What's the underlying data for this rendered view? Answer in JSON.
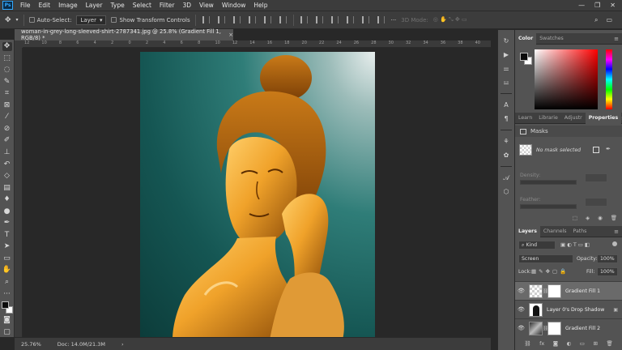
{
  "menubar": {
    "logo": "Ps",
    "items": [
      "File",
      "Edit",
      "Image",
      "Layer",
      "Type",
      "Select",
      "Filter",
      "3D",
      "View",
      "Window",
      "Help"
    ],
    "win_min": "—",
    "win_max": "❐",
    "win_close": "✕"
  },
  "options": {
    "auto_select_label": "Auto-Select:",
    "auto_select_value": "Layer",
    "transform_label": "Show Transform Controls",
    "mode_3d": "3D Mode:"
  },
  "document": {
    "tab_title": "woman-in-grey-long-sleeved-shirt-2787341.jpg @ 25.8% (Gradient Fill 1, RGB/8) *",
    "close_glyph": "×",
    "zoom": "25.76%",
    "doc_info": "Doc: 14.0M/21.3M",
    "ruler_ticks": [
      "12",
      "10",
      "8",
      "6",
      "4",
      "2",
      "0",
      "2",
      "4",
      "6",
      "8",
      "10",
      "12",
      "14",
      "16",
      "18",
      "20",
      "22",
      "24",
      "26",
      "28",
      "30",
      "32",
      "34",
      "36",
      "38",
      "40"
    ]
  },
  "color_panel": {
    "tabs": [
      "Color",
      "Swatches"
    ],
    "fg_color": "#0c0c0c",
    "bg_color": "#ffffff"
  },
  "properties_panel": {
    "tabs": [
      "Learn",
      "Librarie",
      "Adjustr",
      "Properties"
    ],
    "section": "Masks",
    "mask_status": "No mask selected",
    "density_label": "Density:",
    "feather_label": "Feather:"
  },
  "layers_panel": {
    "tabs": [
      "Layers",
      "Channels",
      "Paths"
    ],
    "filter_kind": "Kind",
    "blend_mode": "Screen",
    "opacity_label": "Opacity:",
    "opacity_value": "100%",
    "lock_label": "Lock:",
    "fill_label": "Fill:",
    "fill_value": "100%",
    "layers": [
      {
        "name": "Gradient Fill 1",
        "selected": true
      },
      {
        "name": "Layer 0's Drop Shadow",
        "selected": false
      },
      {
        "name": "Gradient Fill 2",
        "selected": false
      }
    ],
    "footer_fx": "fx"
  }
}
